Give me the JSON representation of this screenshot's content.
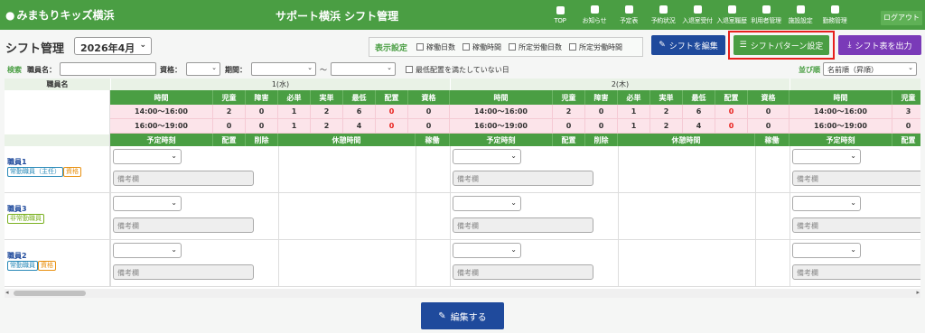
{
  "app": {
    "logo": "みまもりキッズ横浜",
    "title": "サポート横浜 シフト管理",
    "logout": "ログアウト"
  },
  "nav": [
    {
      "icon": "home-icon",
      "label": "TOP"
    },
    {
      "icon": "megaphone-icon",
      "label": "お知らせ"
    },
    {
      "icon": "calendar-icon",
      "label": "予定表"
    },
    {
      "icon": "list-icon",
      "label": "予約状況"
    },
    {
      "icon": "sign-in-icon",
      "label": "入退室受付"
    },
    {
      "icon": "history-icon",
      "label": "入退室履歴"
    },
    {
      "icon": "user-icon",
      "label": "利用者管理"
    },
    {
      "icon": "gear-icon",
      "label": "施設設定"
    },
    {
      "icon": "server-icon",
      "label": "勤務管理"
    }
  ],
  "page_title": "シフト管理",
  "month": "2026年4月",
  "display": {
    "label": "表示設定",
    "options": [
      "稼働日数",
      "稼働時間",
      "所定労働日数",
      "所定労働時間"
    ]
  },
  "buttons": {
    "edit_shift": "シフトを編集",
    "pattern": "シフトパターン設定",
    "export": "シフト表を出力",
    "save": "編集する"
  },
  "filter": {
    "search": "検索",
    "staff_label": "職員名：",
    "qual_label": "資格：",
    "period_label": "期間：",
    "tilde": "〜",
    "min_label": "最低配置を満たしていない日",
    "sort_label": "並び順",
    "sort_value": "名前順（昇順）"
  },
  "table": {
    "name_header": "職員名",
    "days": [
      {
        "label": "1(水)"
      },
      {
        "label": "2(木)"
      }
    ],
    "cols": [
      "時間",
      "児童",
      "障害",
      "必単",
      "実単",
      "最低",
      "配置",
      "資格"
    ],
    "rows": [
      {
        "day": 0,
        "cells": [
          "14:00〜16:00",
          "2",
          "0",
          "1",
          "2",
          "6",
          "0",
          "0"
        ]
      },
      {
        "day": 0,
        "cells": [
          "16:00〜19:00",
          "0",
          "0",
          "1",
          "2",
          "4",
          "0",
          "0"
        ]
      },
      {
        "day": 1,
        "cells": [
          "14:00〜16:00",
          "2",
          "0",
          "1",
          "2",
          "6",
          "0",
          "0"
        ]
      },
      {
        "day": 1,
        "cells": [
          "16:00〜19:00",
          "0",
          "0",
          "1",
          "2",
          "4",
          "0",
          "0"
        ]
      },
      {
        "day": 2,
        "cells": [
          "14:00〜16:00",
          "3"
        ]
      },
      {
        "day": 2,
        "cells": [
          "16:00〜19:00",
          "0"
        ]
      }
    ],
    "sub_cols": [
      "予定時刻",
      "配置",
      "削除",
      "休憩時間",
      "稼働"
    ],
    "memo_placeholder": "備考欄",
    "staff": [
      {
        "name": "職員1",
        "badges": [
          {
            "text": "常勤職員（主任）",
            "type": "j"
          },
          {
            "text": "資格",
            "type": "s"
          }
        ]
      },
      {
        "name": "職員3",
        "badges": [
          {
            "text": "非常勤職員",
            "type": "h"
          }
        ]
      },
      {
        "name": "職員2",
        "badges": [
          {
            "text": "常勤職員",
            "type": "j"
          },
          {
            "text": "資格",
            "type": "s"
          }
        ]
      }
    ]
  },
  "colors": {
    "green": "#4a9e43",
    "navy": "#1f4a9c",
    "purple": "#7a3ab8",
    "pink": "#fce4ea",
    "highlight": "#e8201c"
  }
}
